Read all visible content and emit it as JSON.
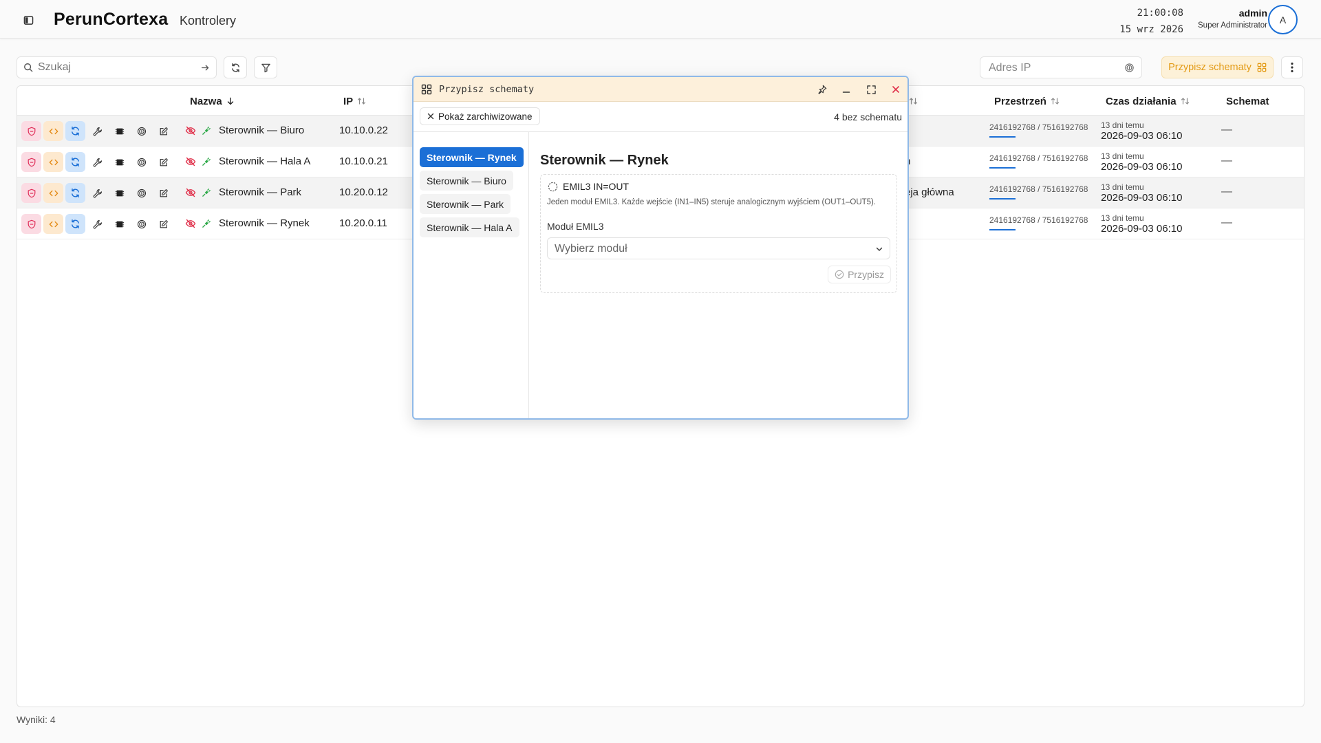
{
  "header": {
    "app_title": "PerunCortexa",
    "page_name": "Kontrolery",
    "time": "21:00:08",
    "date": "15 wrz 2026",
    "user_name": "admin",
    "user_role": "Super Administrator",
    "avatar_initial": "A"
  },
  "toolbar": {
    "search_placeholder": "Szukaj",
    "ip_placeholder": "Adres IP",
    "assign_schemas_label": "Przypisz schematy",
    "accent_color": "#e39a14"
  },
  "table": {
    "columns": {
      "name": "Nazwa",
      "ip": "IP",
      "space": "Przestrzeń",
      "uptime": "Czas działania",
      "schema": "Schemat"
    },
    "rows": [
      {
        "name": "Sterownik — Biuro",
        "ip": "10.10.0.22",
        "location": "",
        "space": "2416192768 / 7516192768",
        "uptime_ago": "13 dni temu",
        "uptime_date": "2026-09-03 06:10",
        "schema": "—"
      },
      {
        "name": "Sterownik — Hala A",
        "ip": "10.10.0.21",
        "location": "n",
        "space": "2416192768 / 7516192768",
        "uptime_ago": "13 dni temu",
        "uptime_date": "2026-09-03 06:10",
        "schema": "—"
      },
      {
        "name": "Sterownik — Park",
        "ip": "10.20.0.12",
        "location": "eja główna",
        "space": "2416192768 / 7516192768",
        "uptime_ago": "13 dni temu",
        "uptime_date": "2026-09-03 06:10",
        "schema": "—"
      },
      {
        "name": "Sterownik — Rynek",
        "ip": "10.20.0.11",
        "location": "",
        "space": "2416192768 / 7516192768",
        "uptime_ago": "13 dni temu",
        "uptime_date": "2026-09-03 06:10",
        "schema": "—"
      }
    ],
    "results_label": "Wyniki: 4"
  },
  "modal": {
    "title": "Przypisz schematy",
    "show_archived_label": "Pokaż zarchiwizowane",
    "without_schema_label": "4 bez schematu",
    "controllers": [
      {
        "name": "Sterownik — Rynek",
        "active": true
      },
      {
        "name": "Sterownik — Biuro",
        "active": false
      },
      {
        "name": "Sterownik — Park",
        "active": false
      },
      {
        "name": "Sterownik — Hala A",
        "active": false
      }
    ],
    "selected_controller": "Sterownik — Rynek",
    "schema": {
      "name": "EMIL3 IN=OUT",
      "description": "Jeden moduł EMIL3. Każde wejście (IN1–IN5) steruje analogicznym wyjściem (OUT1–OUT5).",
      "module_label": "Moduł EMIL3",
      "module_placeholder": "Wybierz moduł",
      "assign_label": "Przypisz"
    }
  }
}
